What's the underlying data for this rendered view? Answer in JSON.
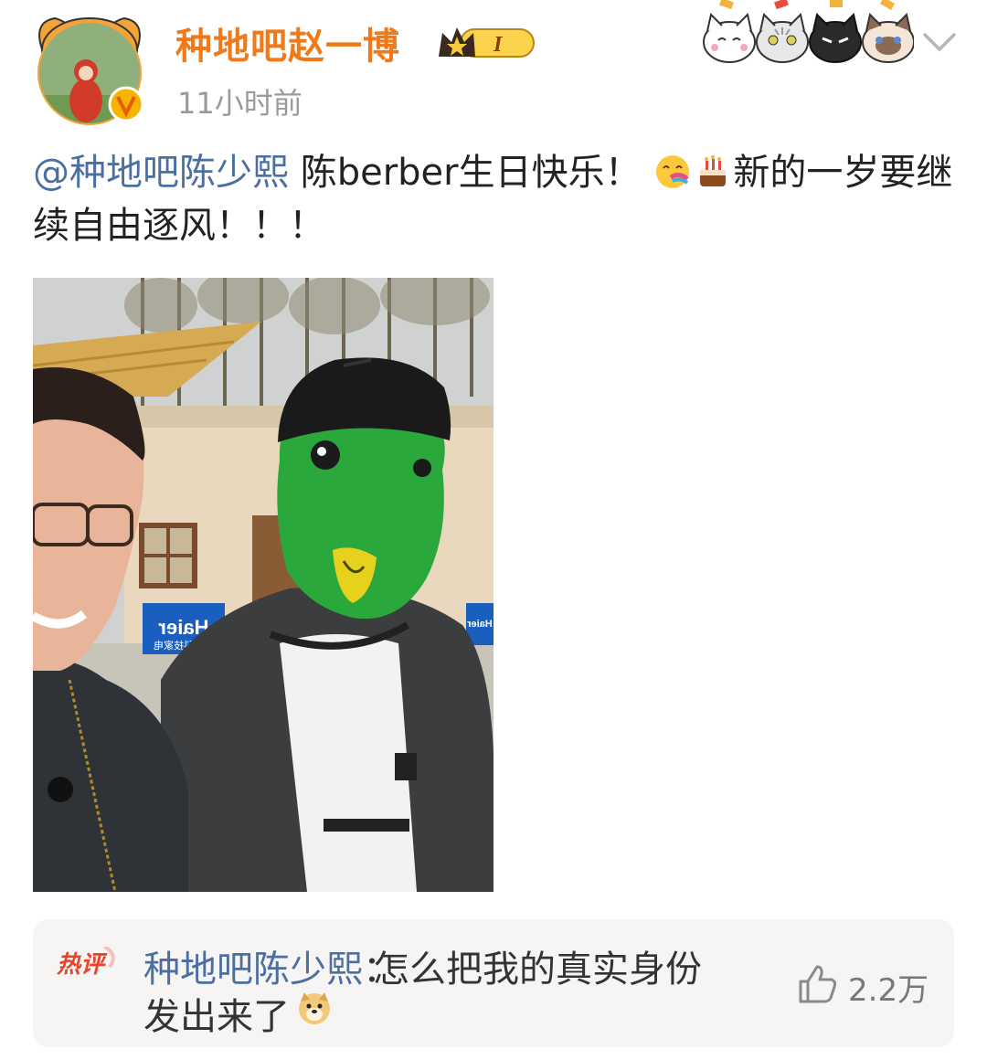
{
  "post": {
    "author_name": "种地吧赵一博",
    "timestamp": "11小时前",
    "member_badge_level": "I",
    "mention": "@种地吧陈少熙",
    "text_part1": " 陈berber生日快乐！",
    "text_part2": "新的一岁要继续自由逐风！！！",
    "inline_emojis": [
      "happy-face-emoji",
      "birthday-cake-emoji"
    ]
  },
  "photo": {
    "signs": [
      "Haier",
      "智慧科技家电",
      "Haier"
    ]
  },
  "hot_comment": {
    "label": "热评",
    "author": "种地吧陈少熙",
    "separator": "：",
    "text_line1": "怎么把我的真实身份",
    "text_line2": "发出来了",
    "emoji": "doge-emoji",
    "likes": "2.2万"
  },
  "colors": {
    "username": "#f07a1a",
    "link": "#4a6fa0",
    "hot_label": "#e8432a",
    "comment_bg": "#f7f4f4",
    "timestamp": "#9a9a9a"
  },
  "icons": [
    "avatar",
    "verified-badge-icon",
    "crown-member-icon",
    "cat-sticker",
    "chevron-down-icon",
    "like-icon",
    "doge-emoji"
  ]
}
